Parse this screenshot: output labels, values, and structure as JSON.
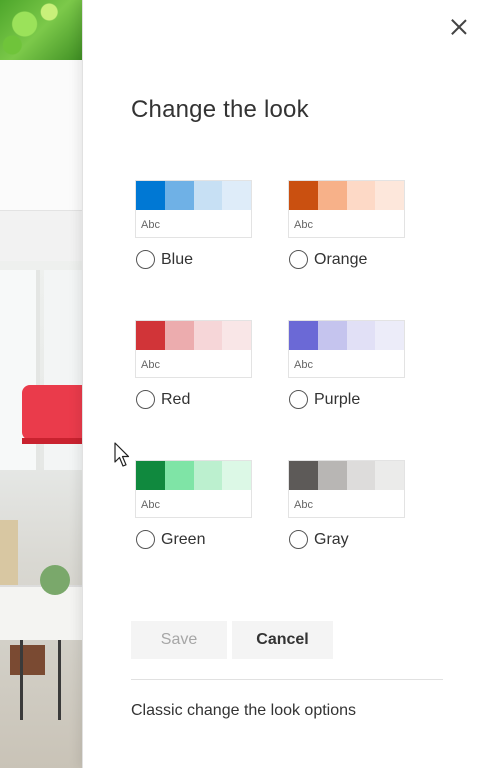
{
  "panel": {
    "title": "Change the look",
    "close_icon": "close-icon",
    "themes": [
      {
        "name": "Blue",
        "sample": "Abc",
        "colors": [
          "#0078d4",
          "#6fb1e6",
          "#c7e0f4",
          "#deecf9"
        ]
      },
      {
        "name": "Orange",
        "sample": "Abc",
        "colors": [
          "#ca5010",
          "#f7b189",
          "#fdd9c6",
          "#fde7db"
        ]
      },
      {
        "name": "Red",
        "sample": "Abc",
        "colors": [
          "#d13438",
          "#ecacae",
          "#f6d6d8",
          "#f9e6e7"
        ]
      },
      {
        "name": "Purple",
        "sample": "Abc",
        "colors": [
          "#6b69d6",
          "#c5c4ee",
          "#e1e0f6",
          "#ececf9"
        ]
      },
      {
        "name": "Green",
        "sample": "Abc",
        "colors": [
          "#10893e",
          "#7fe4a6",
          "#bcf0cf",
          "#dcf8e6"
        ]
      },
      {
        "name": "Gray",
        "sample": "Abc",
        "colors": [
          "#5d5a58",
          "#b8b6b4",
          "#dddcdb",
          "#ebebea"
        ]
      }
    ],
    "save_label": "Save",
    "cancel_label": "Cancel",
    "classic_link": "Classic change the look options"
  }
}
